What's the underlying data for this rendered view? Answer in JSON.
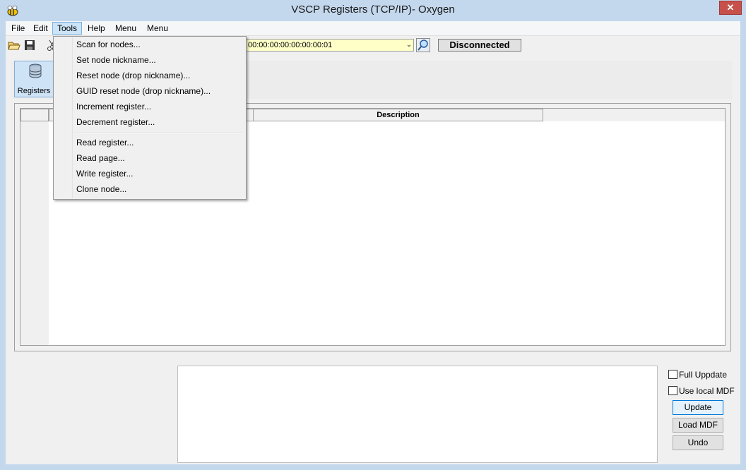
{
  "window": {
    "title": "VSCP Registers (TCP/IP)- Oxygen",
    "close_glyph": "✕"
  },
  "menubar": {
    "items": [
      {
        "label": "File"
      },
      {
        "label": "Edit"
      },
      {
        "label": "Tools"
      },
      {
        "label": "Help"
      },
      {
        "label": "Menu"
      },
      {
        "label": "Menu"
      }
    ],
    "active": "Tools"
  },
  "toolbar": {
    "guid_value": "00:00:00:00:00:00:00:01",
    "connection_status": "Disconnected",
    "icons": [
      "folder-open-icon",
      "save-icon",
      "cut-icon",
      "search-icon"
    ]
  },
  "ribbon": {
    "registers_label": "Registers"
  },
  "grid": {
    "columns": [
      "Description"
    ]
  },
  "tools_menu": {
    "group1": [
      "Scan for nodes...",
      "Set node nickname...",
      "Reset node (drop nickname)...",
      "GUID reset node (drop nickname)...",
      "Increment register...",
      "Decrement register..."
    ],
    "group2": [
      "Read register...",
      "Read page...",
      "Write register...",
      "Clone node..."
    ]
  },
  "options": {
    "full_update_label": "Full Uppdate",
    "use_local_mdf_label": "Use local MDF",
    "full_update_checked": false,
    "use_local_mdf_checked": false
  },
  "buttons": {
    "update": "Update",
    "load_mdf": "Load MDF",
    "undo": "Undo"
  },
  "colors": {
    "frame": "#c3d7ed",
    "guid_bg": "#ffffc8",
    "close": "#c7504a",
    "menu_highlight": "#cce4f7"
  }
}
